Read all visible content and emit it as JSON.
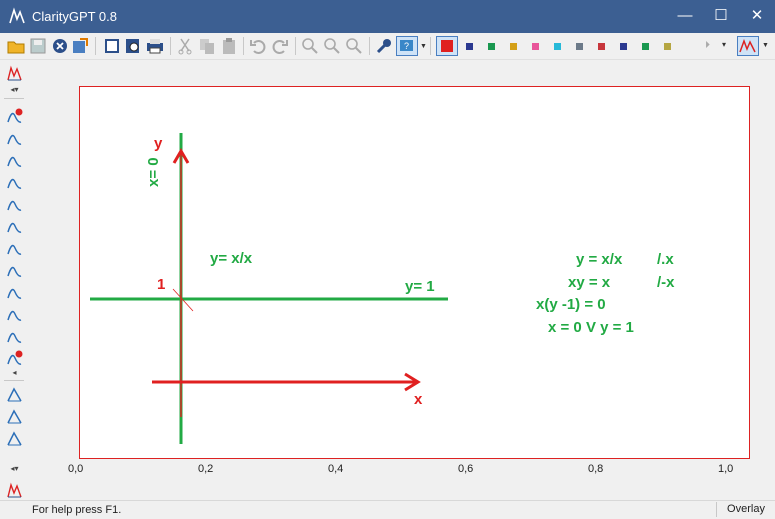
{
  "window": {
    "title": "ClarityGPT 0.8",
    "minimize_glyph": "—",
    "maximize_glyph": "☐",
    "close_glyph": "✕"
  },
  "toolbar": {
    "icons": [
      "open-folder-icon",
      "save-icon",
      "close-doc-icon",
      "export-icon",
      "gallery-icon",
      "print-preview-icon",
      "print-icon",
      "cut-icon",
      "copy-icon",
      "paste-icon",
      "undo-icon",
      "redo-icon",
      "zoom-in-icon",
      "zoom-fit-icon",
      "zoom-out-icon",
      "wrench-icon",
      "help-icon",
      "color-red-selected",
      "overlay-icon"
    ],
    "color_swatches": [
      "#2b3990",
      "#1a9850",
      "#d4a017",
      "#e8559a",
      "#27b9d8",
      "#6c7a89",
      "#c7363c",
      "#2b3990",
      "#1a9850",
      "#b5a642"
    ],
    "selected_color": "#e02020"
  },
  "axis": {
    "x_ticks": [
      "0,0",
      "0,2",
      "0,4",
      "0,6",
      "0,8",
      "1,0"
    ]
  },
  "annotations": {
    "y_label": "y",
    "x_label": "x",
    "x_eq_0": "x= 0",
    "y_eq_1": "y= 1",
    "one": "1",
    "y_eq_x_over_x": "y= x/x",
    "derivation": {
      "line1": "y = x/x",
      "line1_note": "/.x",
      "line2": "xy = x",
      "line2_note": "/-x",
      "line3": "x(y -1) = 0",
      "line4": "x = 0 V y = 1"
    }
  },
  "colors": {
    "green": "#22aa44",
    "red": "#e02020",
    "frame": "#d22222"
  },
  "status": {
    "help": "For help press F1.",
    "mode": "Overlay"
  }
}
